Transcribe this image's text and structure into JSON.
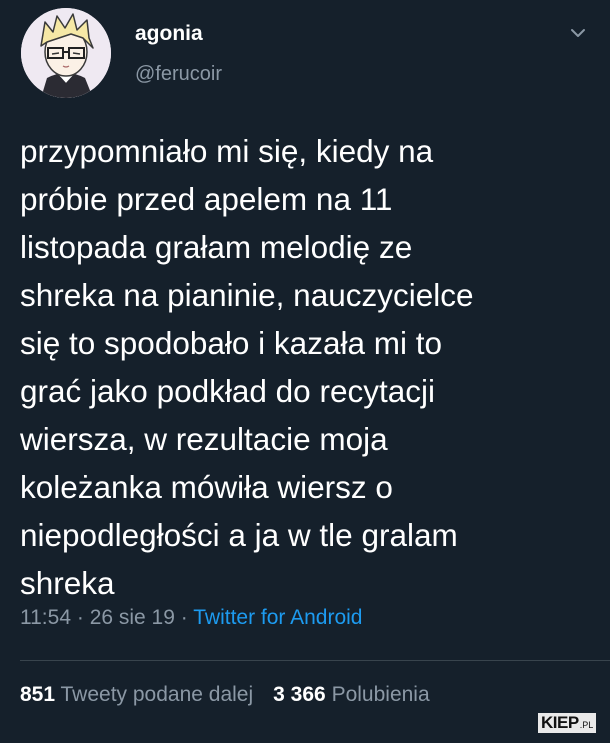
{
  "author": {
    "display_name": "agonia",
    "handle": "@ferucoir",
    "avatar_icon": "anime-avatar-icon"
  },
  "menu_icon": "chevron-down-icon",
  "tweet": {
    "lines": [
      "przypomniało mi się, kiedy na",
      "próbie przed apelem na 11",
      "listopada grałam melodię ze",
      "shreka na pianinie, nauczycielce",
      "się to spodobało i kazała mi to",
      "grać jako podkład do recytacji",
      "wiersza, w rezultacie moja",
      "koleżanka mówiła wiersz o",
      "niepodległości a ja w tle gralam",
      "shreka"
    ],
    "time": "11:54",
    "date": "26 sie 19",
    "separator": "·",
    "source": "Twitter for Android"
  },
  "stats": {
    "retweets_count": "851",
    "retweets_label": "Tweety podane dalej",
    "likes_count": "3 366",
    "likes_label": "Polubienia"
  },
  "watermark": {
    "main": "KIEP",
    "tld": ".PL"
  },
  "colors": {
    "background": "#15202b",
    "text": "#ffffff",
    "secondary": "#8b98a5",
    "link": "#1d9bf0",
    "divider": "#38444d"
  }
}
